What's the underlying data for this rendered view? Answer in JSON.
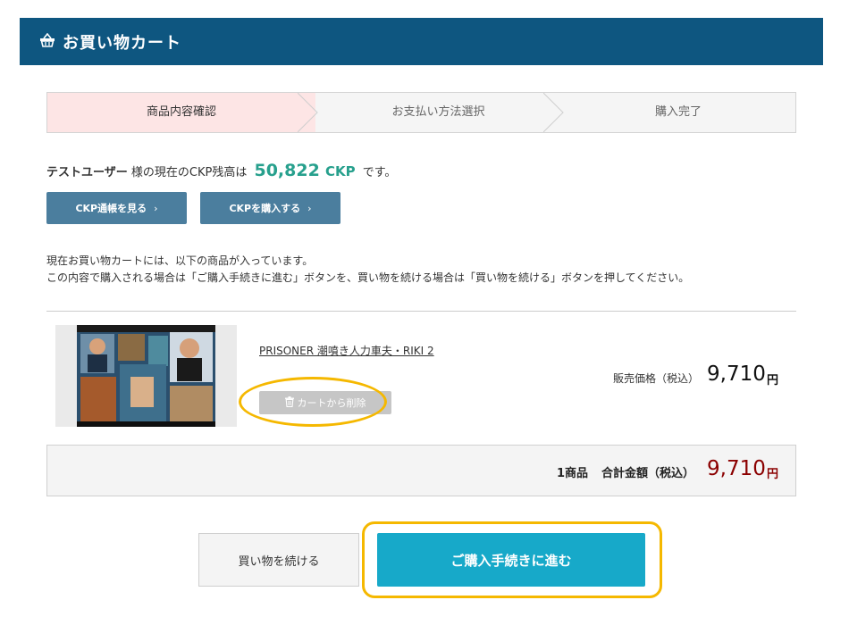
{
  "header": {
    "title": "お買い物カート",
    "icon": "basket-icon"
  },
  "steps": [
    {
      "label": "商品内容確認",
      "active": true
    },
    {
      "label": "お支払い方法選択",
      "active": false
    },
    {
      "label": "購入完了",
      "active": false
    }
  ],
  "balance": {
    "user": "テストユーザー",
    "prefix": "様の現在のCKP残高は",
    "amount": "50,822",
    "unit": "CKP",
    "suffix": "です。"
  },
  "buttons": {
    "passbook": "CKP通帳を見る",
    "buy_ckp": "CKPを購入する",
    "continue_shopping": "買い物を続ける",
    "proceed": "ご購入手続きに進む"
  },
  "description": {
    "line1": "現在お買い物カートには、以下の商品が入っています。",
    "line2": "この内容で購入される場合は「ご購入手続きに進む」ボタンを、買い物を続ける場合は「買い物を続ける」ボタンを押してください。"
  },
  "item": {
    "title": "PRISONER 潮噴き人力車夫・RIKI 2",
    "remove_label": "カートから削除",
    "price_label": "販売価格（税込）",
    "price": "9,710",
    "yen": "円"
  },
  "total": {
    "count": "1商品",
    "label": "合計金額（税込）",
    "price": "9,710",
    "yen": "円"
  },
  "colors": {
    "header_bg": "#0e5680",
    "active_step_bg": "#fde5e5",
    "balance_accent": "#27a08d",
    "ckp_button": "#4b7e9e",
    "total_price": "#8b0000",
    "proceed_button": "#17a9c9",
    "highlight": "#f5b800"
  }
}
